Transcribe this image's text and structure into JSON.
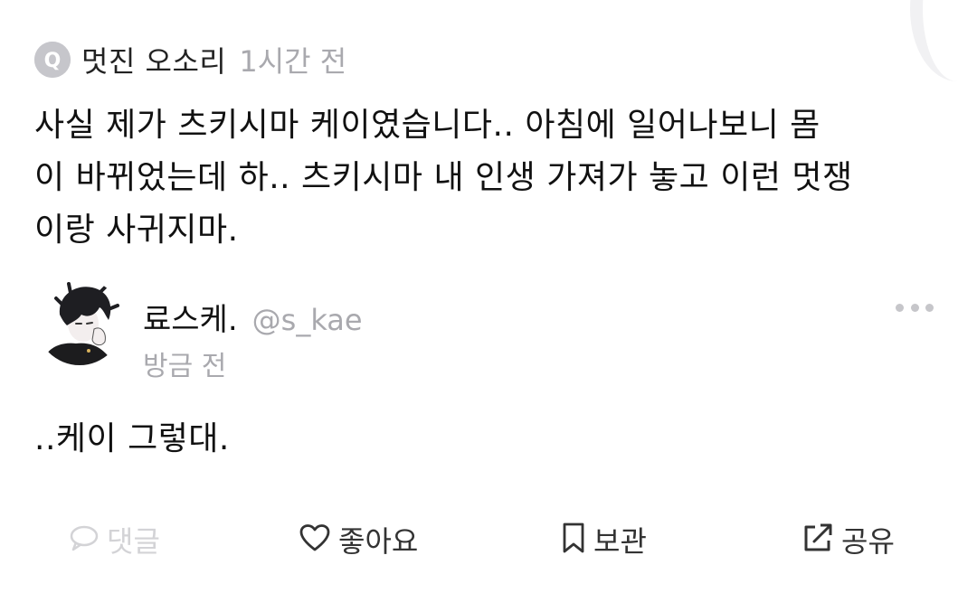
{
  "question": {
    "icon": "q-circle-icon",
    "icon_letter": "Q",
    "author": "멋진 오소리",
    "time": "1시간 전",
    "body_lines": [
      "사실 제가 츠키시마 케이였습니다.. 아침에 일어나보니 몸",
      "이 바뀌었는데 하.. 츠키시마 내 인생 가져가 놓고 이런 멋쟁",
      "이랑 사귀지마."
    ]
  },
  "answer": {
    "avatar": "avatar-image",
    "name": "료스케.",
    "handle": "@s_kae",
    "time": "방금 전",
    "body": "..케이 그렇대.",
    "more_icon": "more-dots-icon"
  },
  "actions": {
    "comment_label": "댓글",
    "like_label": "좋아요",
    "save_label": "보관",
    "share_label": "공유"
  },
  "colors": {
    "muted": "#a9a9ae",
    "disabled": "#d3d3d6",
    "text": "#111111"
  }
}
